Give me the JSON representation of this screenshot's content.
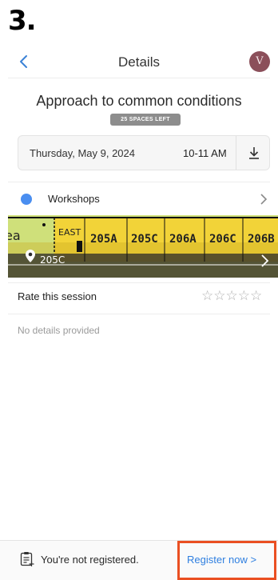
{
  "step_marker": "3.",
  "header": {
    "title": "Details",
    "avatar_initial": "V"
  },
  "session": {
    "title": "Approach to common conditions",
    "spaces_badge": "25 SPACES LEFT",
    "date": "Thursday, May 9, 2024",
    "time": "10-11 AM"
  },
  "track": {
    "label": "Workshops",
    "dot_color": "#4a8ef0"
  },
  "map": {
    "labels": [
      "ea",
      "EAST",
      "205A",
      "205C",
      "206A",
      "206C",
      "206B"
    ],
    "location_label": "205C",
    "room_fill_color": "#f2d338",
    "area_fill_color": "#cfe07a"
  },
  "rating": {
    "label": "Rate this session",
    "stars": "☆☆☆☆☆"
  },
  "details": {
    "empty_text": "No details provided"
  },
  "footer": {
    "registration_status": "You're not registered.",
    "register_label": "Register now >",
    "highlight_color": "#ea4f22"
  }
}
